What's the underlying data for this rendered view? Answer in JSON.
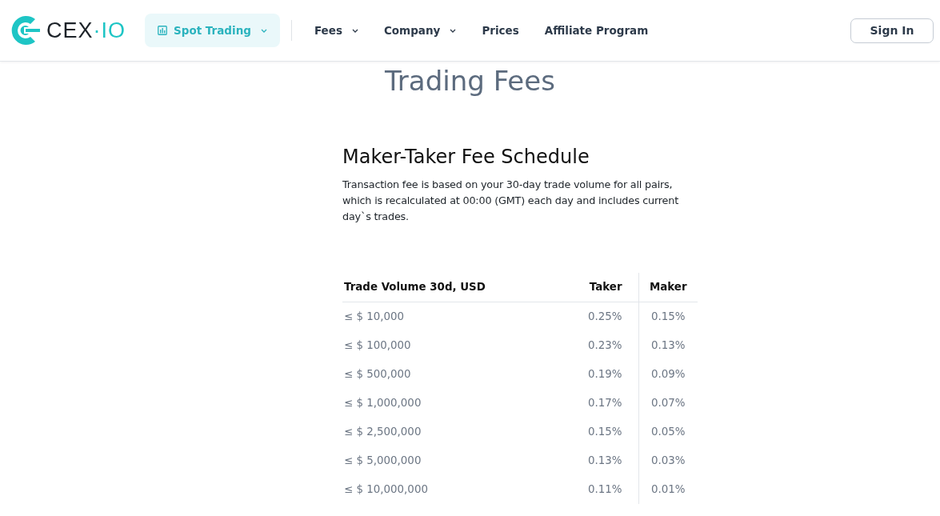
{
  "logo": {
    "brand": "CEX",
    "suffix": "·IO"
  },
  "nav": [
    {
      "label": "Spot Trading",
      "selected": true,
      "dropdown": true
    },
    {
      "label": "Fees",
      "selected": false,
      "dropdown": true
    },
    {
      "label": "Company",
      "selected": false,
      "dropdown": true
    },
    {
      "label": "Prices",
      "selected": false,
      "dropdown": false
    },
    {
      "label": "Affiliate Program",
      "selected": false,
      "dropdown": false
    }
  ],
  "sign_in": "Sign In",
  "page_title": "Trading Fees",
  "section_title": "Maker-Taker Fee Schedule",
  "description": "Transaction fee is based on your 30-day trade volume for all pairs, which is recalculated at 00:00 (GMT) each day and includes current day`s trades.",
  "table": {
    "columns": [
      "Trade Volume 30d, USD",
      "Taker",
      "Maker"
    ],
    "rows": [
      [
        "≤  $ 10,000",
        "0.25%",
        "0.15%"
      ],
      [
        "≤  $ 100,000",
        "0.23%",
        "0.13%"
      ],
      [
        "≤  $ 500,000",
        "0.19%",
        "0.09%"
      ],
      [
        "≤  $ 1,000,000",
        "0.17%",
        "0.07%"
      ],
      [
        "≤  $ 2,500,000",
        "0.15%",
        "0.05%"
      ],
      [
        "≤  $ 5,000,000",
        "0.13%",
        "0.03%"
      ],
      [
        "≤  $ 10,000,000",
        "0.11%",
        "0.01%"
      ]
    ]
  }
}
